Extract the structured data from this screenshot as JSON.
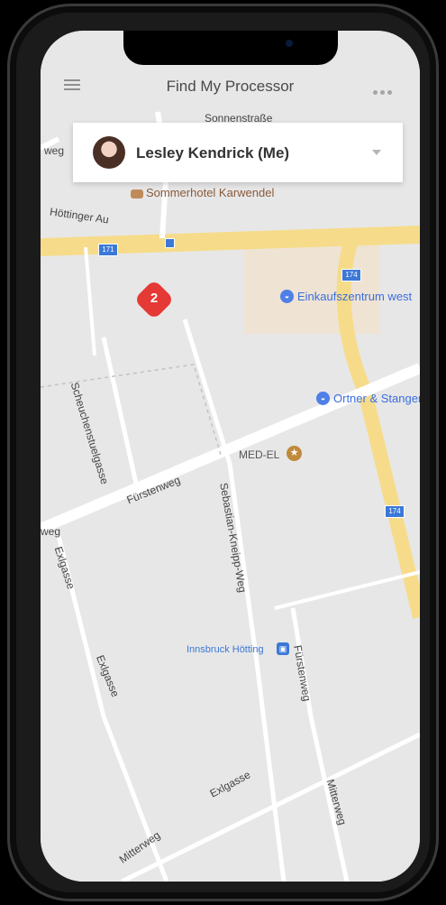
{
  "header": {
    "title": "Find My Processor"
  },
  "user": {
    "name": "Lesley Kendrick (Me)"
  },
  "cluster": {
    "count": "2"
  },
  "map": {
    "streets": {
      "sonnenstrasse": "Sonnenstraße",
      "hoettinger_au": "Höttinger Au",
      "weg_top": "weg",
      "scheuchenstuelgasse": "Scheuchenstuelgasse",
      "fuerstenweg_1": "Fürstenweg",
      "fuerstenweg_2": "Fürstenweg",
      "sebastian_kneipp_weg": "Sebastian-Kneipp-Weg",
      "exlgasse_1": "Exlgasse",
      "exlgasse_2": "Exlgasse",
      "exlgasse_3": "Exlgasse",
      "mitterweg_1": "Mitterweg",
      "mitterweg_2": "Mitterweg",
      "weg_left": "weg"
    },
    "places": {
      "hotel": "Sommerhotel Karwendel",
      "mall": "Einkaufszentrum west",
      "ortner": "Ortner & Stanger",
      "medel": "MED-EL",
      "transit": "Innsbruck Hötting"
    },
    "road_numbers": {
      "r171": "171",
      "r174a": "174",
      "r174b": "174"
    }
  },
  "colors": {
    "accent": "#e53935",
    "poi": "#4f7fe7",
    "highway": "#f6dc8a"
  }
}
